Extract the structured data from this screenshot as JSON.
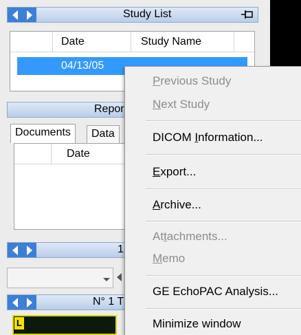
{
  "study_panel": {
    "title": "Study List",
    "columns": [
      "Date",
      "Study Name"
    ],
    "rows": [
      {
        "date": "04/13/05",
        "name": ""
      }
    ]
  },
  "report_panel": {
    "title_partial": "Repor",
    "tabs": [
      "Documents",
      "Data"
    ],
    "columns": [
      "Date"
    ]
  },
  "series_panel": {
    "title_partial": "1"
  },
  "image_panel": {
    "title_partial": "N° 1 T",
    "thumb_badge": "L"
  },
  "context_menu": {
    "items": [
      {
        "label": "Previous Study",
        "mnemonic_index": 0,
        "enabled": false
      },
      {
        "label": "Next Study",
        "mnemonic_index": 0,
        "enabled": false
      },
      {
        "label": "DICOM Information...",
        "mnemonic_index": 6,
        "enabled": true
      },
      {
        "label": "Export...",
        "mnemonic_index": 0,
        "enabled": true
      },
      {
        "label": "Archive...",
        "mnemonic_index": 0,
        "enabled": true
      },
      {
        "label": "Attachments...",
        "mnemonic_index": 2,
        "enabled": false
      },
      {
        "label": "Memo",
        "mnemonic_index": 0,
        "enabled": false
      },
      {
        "label": "GE EchoPAC Analysis...",
        "mnemonic_index": -1,
        "enabled": true
      },
      {
        "label": "Minimize window",
        "mnemonic_index": -1,
        "enabled": true
      }
    ]
  },
  "colors": {
    "header_blue": "#3d7fd6",
    "selection": "#3399ff",
    "disabled_text": "#8d8d8d"
  }
}
